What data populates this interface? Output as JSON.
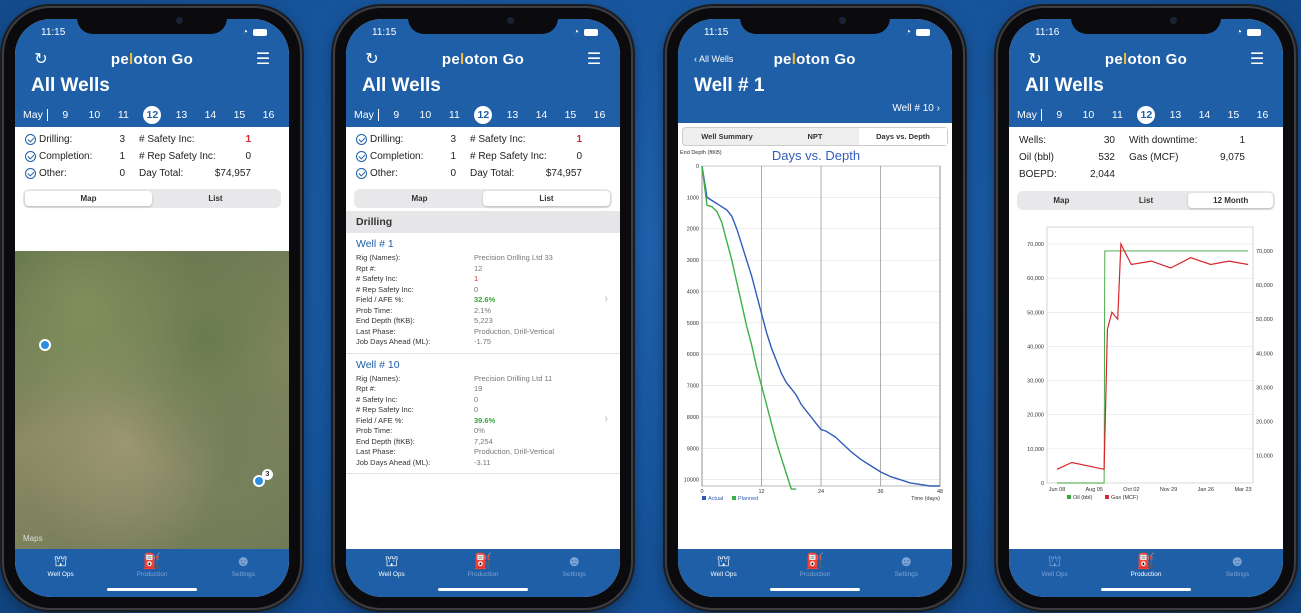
{
  "app": {
    "logo_left": "pe",
    "logo_dot": "l",
    "logo_right": "oton Go",
    "back_label": "All Wells",
    "home_title": "All Wells"
  },
  "dates": {
    "month": "May",
    "days": [
      "9",
      "10",
      "11",
      "12",
      "13",
      "14",
      "15",
      "16"
    ],
    "selected": "12"
  },
  "phone1": {
    "time": "11:15",
    "summary": {
      "drilling_label": "Drilling:",
      "drilling_value": "3",
      "completion_label": "Completion:",
      "completion_value": "1",
      "other_label": "Other:",
      "other_value": "0",
      "safety_label": "# Safety Inc:",
      "safety_value": "1",
      "rep_safety_label": "# Rep Safety Inc:",
      "rep_safety_value": "0",
      "day_total_label": "Day Total:",
      "day_total_value": "$74,957"
    },
    "seg": [
      "Map",
      "List"
    ],
    "seg_selected": "Map",
    "map_label": "Maps",
    "cluster_count": "3"
  },
  "phone2": {
    "time": "11:15",
    "seg": [
      "Map",
      "List"
    ],
    "seg_selected": "List",
    "section": "Drilling",
    "wells": [
      {
        "title": "Well # 1",
        "rows": [
          [
            "Rig (Names):",
            "Precision Drilling Ltd 33"
          ],
          [
            "Rpt #:",
            "12"
          ],
          [
            "# Safety Inc:",
            "1"
          ],
          [
            "# Rep Safety Inc:",
            "0"
          ],
          [
            "Field / AFE %:",
            "32.6%"
          ],
          [
            "Prob Time:",
            "2.1%"
          ],
          [
            "End Depth (ftKB):",
            "5,223"
          ],
          [
            "Last Phase:",
            "Production, Drill-Vertical"
          ],
          [
            "Job Days Ahead (ML):",
            "-1.75"
          ]
        ]
      },
      {
        "title": "Well # 10",
        "rows": [
          [
            "Rig (Names):",
            "Precision Drilling Ltd 11"
          ],
          [
            "Rpt #:",
            "19"
          ],
          [
            "# Safety Inc:",
            "0"
          ],
          [
            "# Rep Safety Inc:",
            "0"
          ],
          [
            "Field / AFE %:",
            "39.6%"
          ],
          [
            "Prob Time:",
            "0%"
          ],
          [
            "End Depth (ftKB):",
            "7,254"
          ],
          [
            "Last Phase:",
            "Production, Drill-Vertical"
          ],
          [
            "Job Days Ahead (ML):",
            "-3.11"
          ]
        ]
      }
    ]
  },
  "phone3": {
    "time": "11:15",
    "well_title": "Well # 1",
    "next_well": "Well # 10",
    "chart_tabs": [
      "Well Summary",
      "NPT",
      "Days vs. Depth"
    ],
    "chart_tab_selected": "Days vs. Depth"
  },
  "phone4": {
    "time": "11:16",
    "stats": {
      "wells_label": "Wells:",
      "wells_value": "30",
      "downtime_label": "With downtime:",
      "downtime_value": "1",
      "oil_label": "Oil (bbl)",
      "oil_value": "532",
      "gas_label": "Gas (MCF)",
      "gas_value": "9,075",
      "boepd_label": "BOEPD:",
      "boepd_value": "2,044"
    },
    "seg": [
      "Map",
      "List",
      "12 Month"
    ],
    "seg_selected": "12 Month"
  },
  "tabbar": {
    "items": [
      "Well Ops",
      "Production",
      "Settings"
    ]
  },
  "colors": {
    "brand_blue": "#1e5fa8",
    "accent_red": "#d8262c",
    "accent_green": "#3aa33a",
    "actual_series": "#2f5cb8",
    "planned_series": "#3bb04a"
  },
  "chart_data": [
    {
      "type": "line",
      "title": "Days vs. Depth",
      "ylabel": "End Depth (ftKB)",
      "xlabel": "Time (days)",
      "xlim": [
        0,
        48
      ],
      "ylim": [
        10000,
        0
      ],
      "x_ticks": [
        0,
        12,
        24,
        36,
        48
      ],
      "y_ticks": [
        0,
        1000,
        2000,
        3000,
        4000,
        5000,
        6000,
        7000,
        8000,
        9000,
        10000
      ],
      "grid": true,
      "legend": "bottom-left",
      "series": [
        {
          "name": "Actual",
          "x": [
            0,
            1,
            2,
            3,
            4,
            5,
            6,
            7,
            8,
            9,
            10,
            11,
            12,
            13,
            14,
            15,
            16,
            17,
            18,
            19,
            20,
            21,
            22,
            23,
            24,
            25,
            26,
            27,
            28,
            29,
            30,
            32,
            34,
            36,
            38,
            40,
            42,
            44,
            46,
            48
          ],
          "y": [
            0,
            1000,
            1100,
            1200,
            1300,
            1400,
            1600,
            2000,
            2500,
            3000,
            3500,
            4100,
            4700,
            5300,
            5800,
            6200,
            6600,
            6900,
            7100,
            7300,
            7600,
            7800,
            8000,
            8200,
            8400,
            8450,
            8550,
            8650,
            8800,
            8950,
            9100,
            9350,
            9550,
            9750,
            9900,
            10000,
            10100,
            10150,
            10200,
            10200
          ]
        },
        {
          "name": "Planned",
          "x": [
            0,
            1,
            2,
            3,
            4,
            5,
            6,
            7,
            8,
            9,
            10,
            11,
            12,
            13,
            14,
            15,
            16,
            17,
            18,
            19
          ],
          "y": [
            0,
            1250,
            1300,
            1450,
            1800,
            2400,
            3000,
            3700,
            4400,
            5100,
            5700,
            6400,
            7000,
            7600,
            8200,
            8800,
            9300,
            9800,
            10300,
            10300
          ]
        }
      ]
    },
    {
      "type": "line",
      "xlabel": "",
      "ylabel": "",
      "categories": [
        "Jun 08",
        "Aug 05",
        "Oct 02",
        "Nov 29",
        "Jan 26",
        "Mar 23"
      ],
      "y_ticks_left": [
        0,
        10000,
        20000,
        30000,
        40000,
        50000,
        60000,
        70000
      ],
      "y_ticks_left_labels": [
        "0",
        "10,000",
        "20,000",
        "30,000",
        "40,000",
        "50,000",
        "60,000",
        "70,000"
      ],
      "y_ticks_right_labels": [
        "10,000",
        "20,000",
        "30,000",
        "40,000",
        "50,000",
        "60,000",
        "70,000"
      ],
      "ylim": [
        0,
        75000
      ],
      "grid": true,
      "legend": "bottom",
      "series": [
        {
          "name": "Oil (bbl)",
          "x": [
            "Jun 08",
            "Jul 15",
            "Aug 20",
            "Aug 21",
            "Mar 31"
          ],
          "y": [
            0,
            0,
            0,
            68000,
            68000
          ]
        },
        {
          "name": "Gas (MCF)",
          "x": [
            "Jun 08",
            "Jul 01",
            "Aug 20",
            "Aug 25",
            "Sep 01",
            "Sep 10",
            "Sep 15",
            "Oct 01",
            "Nov 01",
            "Dec 01",
            "Jan 01",
            "Feb 01",
            "Mar 01",
            "Mar 31"
          ],
          "y": [
            4000,
            6000,
            4000,
            45000,
            50000,
            48000,
            70000,
            64000,
            65000,
            63000,
            66000,
            64000,
            65000,
            64000
          ]
        }
      ]
    }
  ]
}
